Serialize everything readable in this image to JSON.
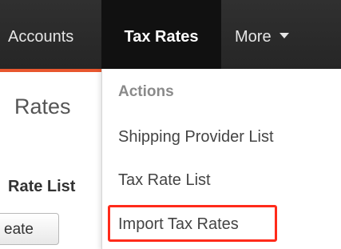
{
  "navbar": {
    "items": [
      {
        "label": "Accounts"
      },
      {
        "label": "Tax Rates",
        "active": true
      },
      {
        "label": "More"
      }
    ],
    "accent_color": "#e8572f",
    "more_icon": "caret-down-icon"
  },
  "page": {
    "title": "Rates",
    "section_title": "Rate List",
    "create_button_label": "eate"
  },
  "dropdown": {
    "header": "Actions",
    "items": [
      {
        "label": "Shipping Provider List"
      },
      {
        "label": "Tax Rate List"
      },
      {
        "label": "Import Tax Rates",
        "highlighted": true
      }
    ],
    "highlight_color": "#ff2a1a"
  }
}
